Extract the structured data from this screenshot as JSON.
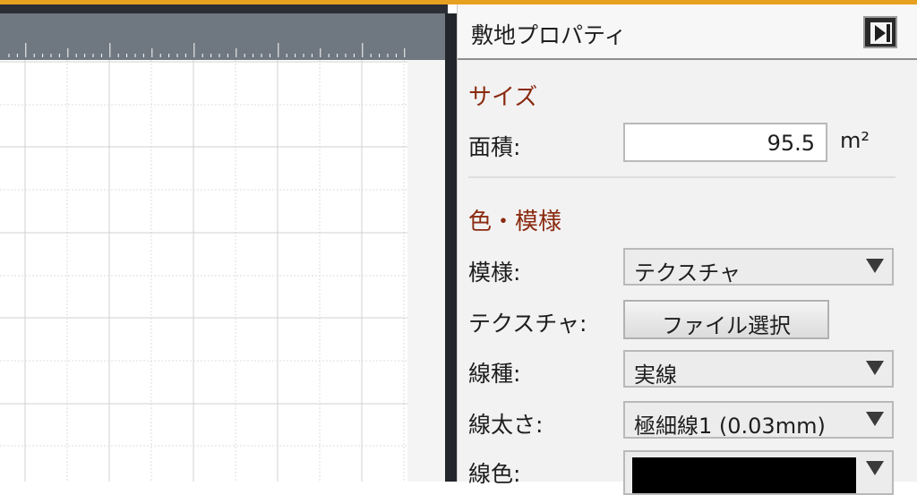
{
  "panel": {
    "title": "敷地プロパティ",
    "collapse_icon": "collapse-right-icon"
  },
  "size_section": {
    "title": "サイズ",
    "area_label": "面積:",
    "area_value": "95.5",
    "area_unit": "m²"
  },
  "style_section": {
    "title": "色・模様",
    "pattern_label": "模様:",
    "pattern_value": "テクスチャ",
    "texture_label": "テクスチャ:",
    "texture_button": "ファイル選択",
    "line_type_label": "線種:",
    "line_type_value": "実線",
    "line_width_label": "線太さ:",
    "line_width_value": "極細線1 (0.03mm)",
    "line_color_label": "線色:",
    "line_color_value": "#000000"
  },
  "colors": {
    "accent": "#e8a020",
    "section_title": "#8b2a10",
    "ruler": "#6f7780",
    "divider": "#23272c"
  }
}
